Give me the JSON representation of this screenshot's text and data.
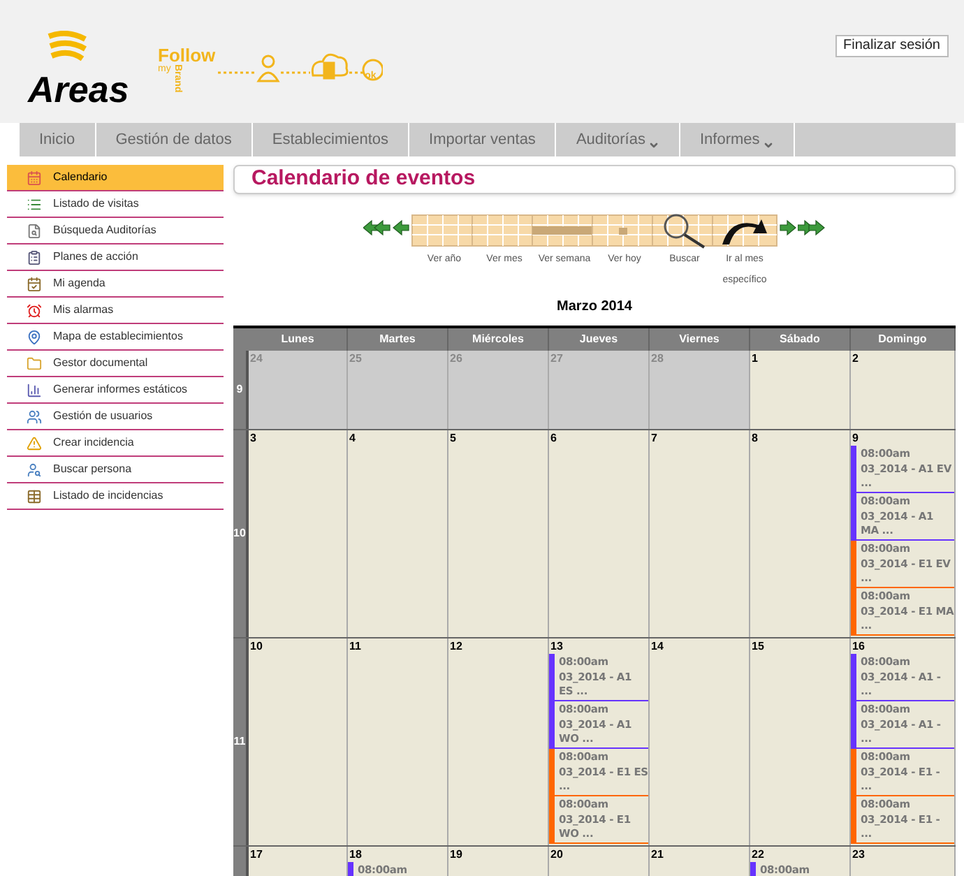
{
  "header": {
    "logo": "Areas",
    "follow": "Follow",
    "my": "my",
    "brand": "Brand",
    "ok": "ok",
    "logout": "Finalizar sesión"
  },
  "nav": [
    {
      "label": "Inicio",
      "dropdown": false
    },
    {
      "label": "Gestión de datos",
      "dropdown": false
    },
    {
      "label": "Establecimientos",
      "dropdown": false
    },
    {
      "label": "Importar ventas",
      "dropdown": false
    },
    {
      "label": "Auditorías",
      "dropdown": true
    },
    {
      "label": "Informes",
      "dropdown": true
    }
  ],
  "sidebar": [
    {
      "label": "Calendario",
      "kind": "calendar",
      "selected": true
    },
    {
      "label": "Listado de visitas",
      "kind": "list",
      "selected": false
    },
    {
      "label": "Búsqueda Auditorías",
      "kind": "search",
      "selected": false
    },
    {
      "label": "Planes de acción",
      "kind": "plan",
      "selected": false
    },
    {
      "label": "Mi agenda",
      "kind": "agenda",
      "selected": false
    },
    {
      "label": "Mis alarmas",
      "kind": "alarm",
      "selected": false
    },
    {
      "label": "Mapa de establecimientos",
      "kind": "map",
      "selected": false
    },
    {
      "label": "Gestor documental",
      "kind": "folder",
      "selected": false
    },
    {
      "label": "Generar informes estáticos",
      "kind": "chart",
      "selected": false
    },
    {
      "label": "Gestión de usuarios",
      "kind": "users",
      "selected": false
    },
    {
      "label": "Crear incidencia",
      "kind": "warning",
      "selected": false
    },
    {
      "label": "Buscar persona",
      "kind": "person",
      "selected": false
    },
    {
      "label": "Listado de incidencias",
      "kind": "table",
      "selected": false
    }
  ],
  "title": "Calendario de eventos",
  "toolbar": [
    {
      "label": "Ver año",
      "kind": "year"
    },
    {
      "label": "Ver mes",
      "kind": "month"
    },
    {
      "label": "Ver semana",
      "kind": "week"
    },
    {
      "label": "Ver hoy",
      "kind": "today"
    },
    {
      "label": "Buscar",
      "kind": "search"
    },
    {
      "label": "Ir al mes específico",
      "kind": "goto"
    }
  ],
  "month": "Marzo 2014",
  "weekdays": [
    "Lunes",
    "Martes",
    "Miércoles",
    "Jueves",
    "Viernes",
    "Sábado",
    "Domingo"
  ],
  "weeks": [
    {
      "number": "9",
      "days": [
        {
          "day": "24",
          "other_month": true
        },
        {
          "day": "25",
          "other_month": true
        },
        {
          "day": "26",
          "other_month": true
        },
        {
          "day": "27",
          "other_month": true
        },
        {
          "day": "28",
          "other_month": true
        },
        {
          "day": "1",
          "other_month": false
        },
        {
          "day": "2",
          "other_month": false
        }
      ]
    },
    {
      "number": "10",
      "days": [
        {
          "day": "3",
          "other_month": false
        },
        {
          "day": "4",
          "other_month": false
        },
        {
          "day": "5",
          "other_month": false
        },
        {
          "day": "6",
          "other_month": false
        },
        {
          "day": "7",
          "other_month": false
        },
        {
          "day": "8",
          "other_month": false
        },
        {
          "day": "9",
          "other_month": false,
          "events": [
            {
              "time": "08:00am",
              "title": "03_2014 - A1 EV ...",
              "color": "#6633ff"
            },
            {
              "time": "08:00am",
              "title": "03_2014 - A1 MA ...",
              "color": "#6633ff"
            },
            {
              "time": "08:00am",
              "title": "03_2014 - E1 EV ...",
              "color": "#ff6600"
            },
            {
              "time": "08:00am",
              "title": "03_2014 - E1 MA ...",
              "color": "#ff6600"
            }
          ]
        }
      ]
    },
    {
      "number": "11",
      "days": [
        {
          "day": "10",
          "other_month": false
        },
        {
          "day": "11",
          "other_month": false
        },
        {
          "day": "12",
          "other_month": false
        },
        {
          "day": "13",
          "other_month": false,
          "events": [
            {
              "time": "08:00am",
              "title": "03_2014 - A1 ES ...",
              "color": "#6633ff"
            },
            {
              "time": "08:00am",
              "title": "03_2014 - A1 WO ...",
              "color": "#6633ff"
            },
            {
              "time": "08:00am",
              "title": "03_2014 - E1 ES ...",
              "color": "#ff6600"
            },
            {
              "time": "08:00am",
              "title": "03_2014 - E1 WO ...",
              "color": "#ff6600"
            }
          ]
        },
        {
          "day": "14",
          "other_month": false
        },
        {
          "day": "15",
          "other_month": false
        },
        {
          "day": "16",
          "other_month": false,
          "events": [
            {
              "time": "08:00am",
              "title": "03_2014 - A1 - ...",
              "color": "#6633ff"
            },
            {
              "time": "08:00am",
              "title": "03_2014 - A1 - ...",
              "color": "#6633ff"
            },
            {
              "time": "08:00am",
              "title": "03_2014 - E1 - ...",
              "color": "#ff6600"
            },
            {
              "time": "08:00am",
              "title": "03_2014 - E1 - ...",
              "color": "#ff6600"
            }
          ]
        }
      ]
    },
    {
      "days": [
        {
          "day": "17",
          "other_month": false
        },
        {
          "day": "18",
          "other_month": false,
          "events": [
            {
              "time": "08:00am",
              "color": "#6633ff"
            }
          ]
        },
        {
          "day": "19",
          "other_month": false
        },
        {
          "day": "20",
          "other_month": false
        },
        {
          "day": "21",
          "other_month": false
        },
        {
          "day": "22",
          "other_month": false,
          "events": [
            {
              "time": "08:00am",
              "color": "#6633ff"
            }
          ]
        },
        {
          "day": "23",
          "other_month": false
        }
      ]
    }
  ]
}
